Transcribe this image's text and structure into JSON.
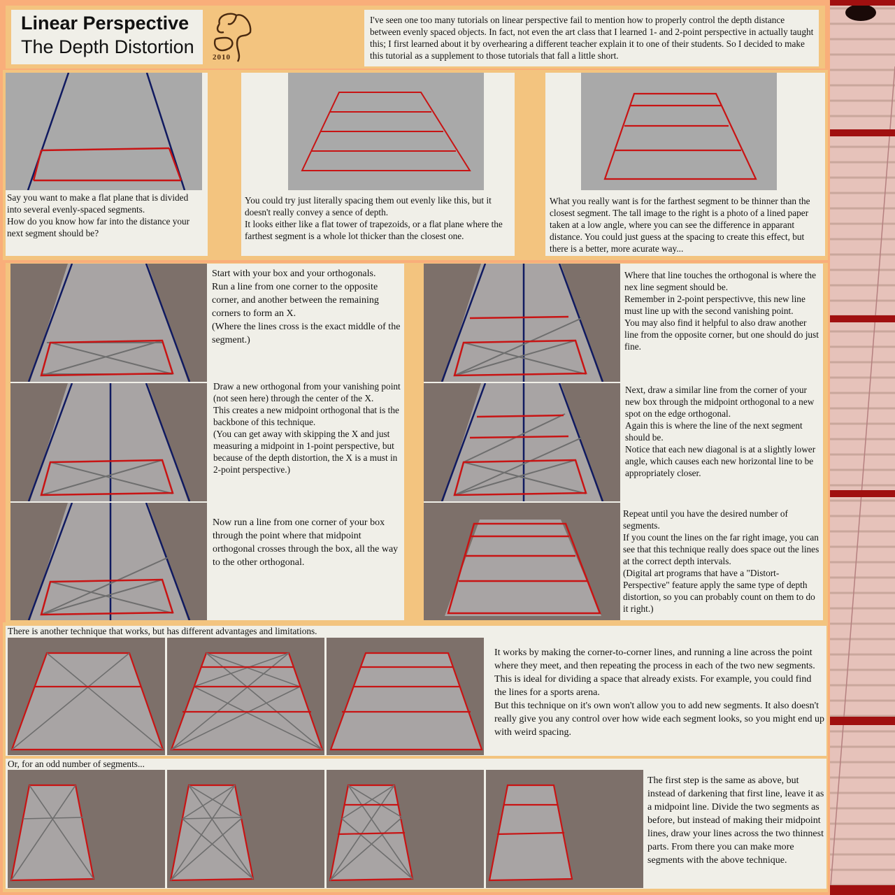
{
  "header": {
    "title": "Linear Perspective",
    "subtitle": "The Depth Distortion",
    "logo_year": "2010",
    "intro": "I've seen one too many tutorials on linear perspective fail to mention how to properly control the depth distance between evenly spaced objects.  In fact, not even the art class that I learned 1- and 2-point perspective in actually taught this; I first learned about it by overhearing a different teacher explain it to one of their students.  So I decided to make this tutorial as a supplement to those tutorials that fall a little short."
  },
  "intro_panels": [
    {
      "text": "Say you want to make a flat plane that is divided into several evenly-spaced segments.\nHow do you know how far into the distance your next segment should be?"
    },
    {
      "text": "You could try just literally spacing them out evenly like this, but it doesn't really convey a sence of depth.\nIt looks either like a flat tower of trapezoids, or a flat plane where the farthest segment is a whole lot thicker than the closest one."
    },
    {
      "text": "What you really want is for the farthest segment to be thinner than the closest segment.  The tall image to the right is a photo of a lined paper taken at a low angle, where you can see the difference in apparant distance.  You could just guess at the spacing to create this effect, but there is a better, more acurate way..."
    }
  ],
  "steps_left": [
    {
      "text": "Start with your box and your orthogonals.\nRun a line from one corner to the opposite corner, and another between the remaining corners to form an X.\n(Where the lines cross is the exact middle of the segment.)"
    },
    {
      "text": "Draw a new orthogonal from your vanishing point (not seen here) through the center of the X.\nThis creates a new midpoint orthogonal that is the backbone of this technique.\n(You can get away with skipping the X and just measuring a midpoint in 1-point perspective, but because of the depth distortion, the X is a must in 2-point perspective.)"
    },
    {
      "text": "Now run a line from one corner of your box through the point where that midpoint orthogonal crosses through the box, all the way to the other orthogonal."
    }
  ],
  "steps_right": [
    {
      "text": "Where that line touches the orthogonal is where the nex line segment should be.\nRemember in 2-point perspectivve, this new line must line up with the second vanishing point.\nYou may also find it helpful to also draw another line from the opposite corner, but one should do just fine."
    },
    {
      "text": "Next, draw a similar line from the corner of your new box through the midpoint orthogonal to a new spot on the edge orthogonal.\nAgain this is where the line of the next segment should be.\nNotice that each new diagonal is at a slightly lower angle, which causes each new horizontal line to be appropriately closer."
    },
    {
      "text": "Repeat until you have the desired number of segments.\nIf you count the lines on the far right image, you can see that this technique really does space out the lines at the correct depth intervals.\n(Digital art programs that have a \"Distort-Perspective\" feature apply the same type of depth distortion, so you can probably count on them to do it right.)"
    }
  ],
  "technique2": {
    "heading": "There is another technique that works, but has different advantages and limitations.",
    "text": "It works by making the corner-to-corner lines, and running a line across the point where they meet, and then repeating the process in each of the two new segments.\nThis is ideal for dividing a space that already exists.  For example, you could find the lines for a sports arena.\nBut this technique on it's own won't allow you to add new segments.  It also doesn't really give you any control over how wide each segment looks, so you might end up with weird spacing."
  },
  "technique3": {
    "heading": "Or, for an odd number of segments...",
    "text": "The first step is the same as above, but instead of darkening that first line, leave it as a midpoint line.  Divide the two segments as before, but instead of making their midpoint lines, draw your lines across the two thinnest parts.  From there you can make more segments with the above technique."
  },
  "colors": {
    "frame": "#f9ae7a",
    "panel": "#f0efe8",
    "accent_orange": "#f3c47f",
    "red_line": "#c81414",
    "blue_line": "#101a60",
    "grey_line": "#6e6e6e"
  }
}
